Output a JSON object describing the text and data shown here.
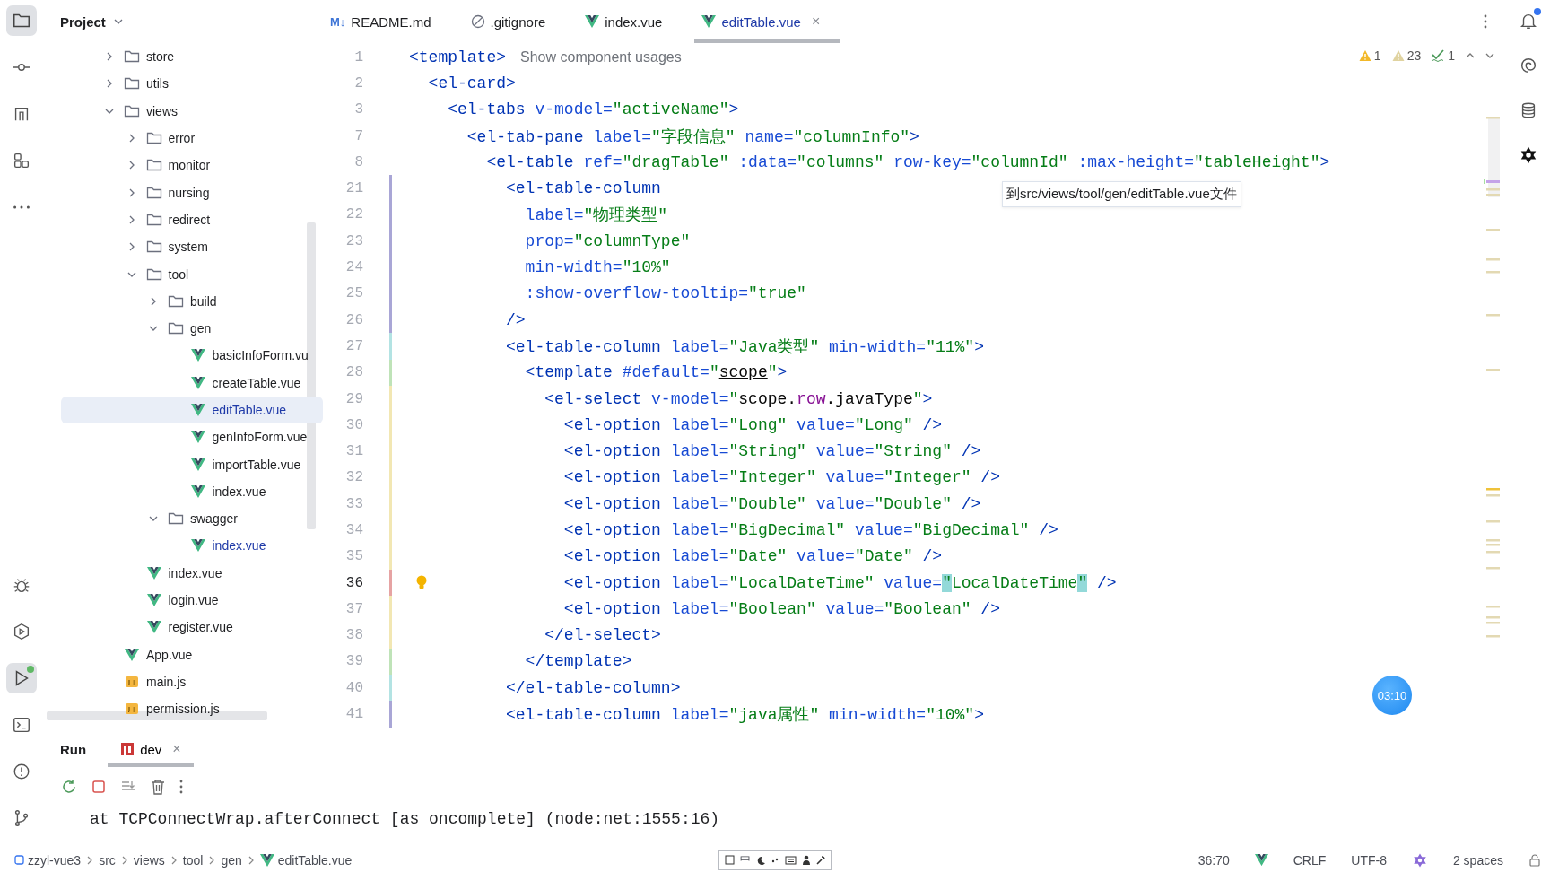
{
  "left_toolbar": {
    "top": [
      {
        "kind": "project",
        "selected": true,
        "badge": false
      },
      {
        "kind": "commit",
        "selected": false,
        "badge": false
      },
      {
        "kind": "structure",
        "selected": false,
        "badge": false
      },
      {
        "kind": "plugins",
        "selected": false,
        "badge": false
      },
      {
        "kind": "more",
        "selected": false,
        "badge": false
      }
    ],
    "bottom": [
      {
        "kind": "debug",
        "selected": false,
        "badge": false
      },
      {
        "kind": "services",
        "selected": false,
        "badge": false
      },
      {
        "kind": "run",
        "selected": true,
        "badge": true
      },
      {
        "kind": "terminal",
        "selected": false,
        "badge": false
      },
      {
        "kind": "problems",
        "selected": false,
        "badge": false
      },
      {
        "kind": "git",
        "selected": false,
        "badge": false
      }
    ]
  },
  "project": {
    "title": "Project",
    "tree": [
      {
        "kind": "folder",
        "label": "store",
        "expanded": false,
        "selected": false
      },
      {
        "kind": "folder",
        "label": "utils",
        "expanded": false,
        "selected": false
      },
      {
        "kind": "folder",
        "label": "views",
        "expanded": true,
        "selected": false,
        "children": [
          {
            "kind": "folder",
            "label": "error",
            "expanded": false,
            "selected": false
          },
          {
            "kind": "folder",
            "label": "monitor",
            "expanded": false,
            "selected": false
          },
          {
            "kind": "folder",
            "label": "nursing",
            "expanded": false,
            "selected": false
          },
          {
            "kind": "folder",
            "label": "redirect",
            "expanded": false,
            "selected": false
          },
          {
            "kind": "folder",
            "label": "system",
            "expanded": false,
            "selected": false
          },
          {
            "kind": "folder",
            "label": "tool",
            "expanded": true,
            "selected": false,
            "children": [
              {
                "kind": "folder",
                "label": "build",
                "expanded": false,
                "selected": false
              },
              {
                "kind": "folder",
                "label": "gen",
                "expanded": true,
                "selected": false,
                "children": [
                  {
                    "kind": "vue",
                    "label": "basicInfoForm.vu",
                    "modified": false,
                    "selected": false
                  },
                  {
                    "kind": "vue",
                    "label": "createTable.vue",
                    "modified": false,
                    "selected": false
                  },
                  {
                    "kind": "vue",
                    "label": "editTable.vue",
                    "modified": true,
                    "selected": true
                  },
                  {
                    "kind": "vue",
                    "label": "genInfoForm.vue",
                    "modified": false,
                    "selected": false
                  },
                  {
                    "kind": "vue",
                    "label": "importTable.vue",
                    "modified": false,
                    "selected": false
                  },
                  {
                    "kind": "vue",
                    "label": "index.vue",
                    "modified": false,
                    "selected": false
                  }
                ]
              },
              {
                "kind": "folder",
                "label": "swagger",
                "expanded": true,
                "selected": false,
                "children": [
                  {
                    "kind": "vue",
                    "label": "index.vue",
                    "modified": true,
                    "selected": false
                  }
                ]
              }
            ]
          },
          {
            "kind": "vue",
            "label": "index.vue",
            "modified": false,
            "selected": false
          },
          {
            "kind": "vue",
            "label": "login.vue",
            "modified": false,
            "selected": false
          },
          {
            "kind": "vue",
            "label": "register.vue",
            "modified": false,
            "selected": false
          }
        ]
      },
      {
        "kind": "vue",
        "label": "App.vue",
        "modified": false,
        "selected": false
      },
      {
        "kind": "js",
        "label": "main.js",
        "modified": false,
        "selected": false
      },
      {
        "kind": "js",
        "label": "permission.js",
        "modified": false,
        "selected": false
      }
    ]
  },
  "tabs": [
    {
      "kind": "markdown",
      "icon_text": "M↓",
      "label": "README.md",
      "selected": false
    },
    {
      "kind": "ignore",
      "label": ".gitignore",
      "selected": false
    },
    {
      "kind": "vue",
      "label": "index.vue",
      "selected": false
    },
    {
      "kind": "vue",
      "label": "editTable.vue",
      "selected": true,
      "close": "×"
    }
  ],
  "inspections": [
    {
      "kind": "warning",
      "count": "1"
    },
    {
      "kind": "weak-warning",
      "count": "23"
    },
    {
      "kind": "typo",
      "count": "1"
    }
  ],
  "code_lines": [
    {
      "number": "1",
      "current": false,
      "tokens": [
        {
          "kind": "tag",
          "text": "<template>"
        },
        {
          "kind": "hint",
          "text": "Show component usages"
        }
      ]
    },
    {
      "number": "2",
      "current": false,
      "tokens": [
        {
          "kind": "tag",
          "text": "  <el-card>"
        }
      ]
    },
    {
      "number": "3",
      "current": false,
      "tokens": [
        {
          "kind": "tag",
          "text": "    <el-tabs"
        },
        {
          "kind": "attr",
          "text": " v-model="
        },
        {
          "kind": "str",
          "text": "\"activeName\""
        },
        {
          "kind": "tag",
          "text": ">"
        }
      ]
    },
    {
      "number": "7",
      "current": false,
      "tokens": [
        {
          "kind": "tag",
          "text": "      <el-tab-pane"
        },
        {
          "kind": "attr",
          "text": " label="
        },
        {
          "kind": "str",
          "text": "\"字段信息\""
        },
        {
          "kind": "attr",
          "text": " name="
        },
        {
          "kind": "str",
          "text": "\"columnInfo\""
        },
        {
          "kind": "tag",
          "text": ">"
        }
      ]
    },
    {
      "number": "8",
      "current": false,
      "tokens": [
        {
          "kind": "tag",
          "text": "        <el-table"
        },
        {
          "kind": "attr",
          "text": " ref="
        },
        {
          "kind": "str",
          "text": "\"dragTable\""
        },
        {
          "kind": "attr",
          "text": " :data="
        },
        {
          "kind": "str",
          "text": "\"columns\""
        },
        {
          "kind": "attr",
          "text": " row-key="
        },
        {
          "kind": "str",
          "text": "\"columnId\""
        },
        {
          "kind": "attr",
          "text": " :max-height="
        },
        {
          "kind": "str",
          "text": "\"tableHeight\""
        },
        {
          "kind": "tag",
          "text": ">"
        }
      ]
    },
    {
      "number": "21",
      "current": false,
      "color": "#a9a6d6",
      "tokens": [
        {
          "kind": "tag",
          "text": "          <el-table-column"
        }
      ]
    },
    {
      "number": "22",
      "current": false,
      "color": "#a9a6d6",
      "tokens": [
        {
          "kind": "attr",
          "text": "            label="
        },
        {
          "kind": "str",
          "text": "\"物理类型\""
        }
      ]
    },
    {
      "number": "23",
      "current": false,
      "color": "#a9a6d6",
      "tokens": [
        {
          "kind": "attr",
          "text": "            prop="
        },
        {
          "kind": "str",
          "text": "\"columnType\""
        }
      ]
    },
    {
      "number": "24",
      "current": false,
      "color": "#a9a6d6",
      "tokens": [
        {
          "kind": "attr",
          "text": "            min-width="
        },
        {
          "kind": "str",
          "text": "\"10%\""
        }
      ]
    },
    {
      "number": "25",
      "current": false,
      "color": "#a9a6d6",
      "tokens": [
        {
          "kind": "attr",
          "text": "            :show-overflow-tooltip="
        },
        {
          "kind": "str",
          "text": "\"true\""
        }
      ]
    },
    {
      "number": "26",
      "current": false,
      "color": "#a9a6d6",
      "tokens": [
        {
          "kind": "tag",
          "text": "          />"
        }
      ]
    },
    {
      "number": "27",
      "current": false,
      "color": "#b3e3e3",
      "tokens": [
        {
          "kind": "tag",
          "text": "          <el-table-column"
        },
        {
          "kind": "attr",
          "text": " label="
        },
        {
          "kind": "str",
          "text": "\"Java类型\""
        },
        {
          "kind": "attr",
          "text": " min-width="
        },
        {
          "kind": "str",
          "text": "\"11%\""
        },
        {
          "kind": "tag",
          "text": ">"
        }
      ]
    },
    {
      "number": "28",
      "current": false,
      "color": "#bfe3b8",
      "tokens": [
        {
          "kind": "tag",
          "text": "            <template"
        },
        {
          "kind": "attr",
          "text": " #default="
        },
        {
          "kind": "str",
          "text": "\""
        },
        {
          "kind": "ref",
          "text": "scope"
        },
        {
          "kind": "str",
          "text": "\""
        },
        {
          "kind": "tag",
          "text": ">"
        }
      ]
    },
    {
      "number": "29",
      "current": false,
      "color": "#f2e7b3",
      "tokens": [
        {
          "kind": "tag",
          "text": "              <el-select"
        },
        {
          "kind": "attr",
          "text": " v-model="
        },
        {
          "kind": "str",
          "text": "\""
        },
        {
          "kind": "ref",
          "text": "scope"
        },
        {
          "kind": "plain",
          "text": "."
        },
        {
          "kind": "prop",
          "text": "row"
        },
        {
          "kind": "plain",
          "text": ".javaType"
        },
        {
          "kind": "str",
          "text": "\""
        },
        {
          "kind": "tag",
          "text": ">"
        }
      ]
    },
    {
      "number": "30",
      "current": false,
      "color": "#f2e7b3",
      "tokens": [
        {
          "kind": "tag",
          "text": "                <el-option"
        },
        {
          "kind": "attr",
          "text": " label="
        },
        {
          "kind": "str",
          "text": "\"Long\""
        },
        {
          "kind": "attr",
          "text": " value="
        },
        {
          "kind": "str",
          "text": "\"Long\""
        },
        {
          "kind": "tag",
          "text": " />"
        }
      ]
    },
    {
      "number": "31",
      "current": false,
      "color": "#f2e7b3",
      "tokens": [
        {
          "kind": "tag",
          "text": "                <el-option"
        },
        {
          "kind": "attr",
          "text": " label="
        },
        {
          "kind": "str",
          "text": "\"String\""
        },
        {
          "kind": "attr",
          "text": " value="
        },
        {
          "kind": "str",
          "text": "\"String\""
        },
        {
          "kind": "tag",
          "text": " />"
        }
      ]
    },
    {
      "number": "32",
      "current": false,
      "color": "#f2e7b3",
      "tokens": [
        {
          "kind": "tag",
          "text": "                <el-option"
        },
        {
          "kind": "attr",
          "text": " label="
        },
        {
          "kind": "str",
          "text": "\"Integer\""
        },
        {
          "kind": "attr",
          "text": " value="
        },
        {
          "kind": "str",
          "text": "\"Integer\""
        },
        {
          "kind": "tag",
          "text": " />"
        }
      ]
    },
    {
      "number": "33",
      "current": false,
      "color": "#f2e7b3",
      "tokens": [
        {
          "kind": "tag",
          "text": "                <el-option"
        },
        {
          "kind": "attr",
          "text": " label="
        },
        {
          "kind": "str",
          "text": "\"Double\""
        },
        {
          "kind": "attr",
          "text": " value="
        },
        {
          "kind": "str",
          "text": "\"Double\""
        },
        {
          "kind": "tag",
          "text": " />"
        }
      ]
    },
    {
      "number": "34",
      "current": false,
      "color": "#f2e7b3",
      "tokens": [
        {
          "kind": "tag",
          "text": "                <el-option"
        },
        {
          "kind": "attr",
          "text": " label="
        },
        {
          "kind": "str",
          "text": "\"BigDecimal\""
        },
        {
          "kind": "attr",
          "text": " value="
        },
        {
          "kind": "str",
          "text": "\"BigDecimal\""
        },
        {
          "kind": "tag",
          "text": " />"
        }
      ]
    },
    {
      "number": "35",
      "current": false,
      "color": "#f2e7b3",
      "tokens": [
        {
          "kind": "tag",
          "text": "                <el-option"
        },
        {
          "kind": "attr",
          "text": " label="
        },
        {
          "kind": "str",
          "text": "\"Date\""
        },
        {
          "kind": "attr",
          "text": " value="
        },
        {
          "kind": "str",
          "text": "\"Date\""
        },
        {
          "kind": "tag",
          "text": " />"
        }
      ]
    },
    {
      "number": "36",
      "current": true,
      "color": "#e6a3a3",
      "tokens": [
        {
          "kind": "tag",
          "text": "                <el-option"
        },
        {
          "kind": "attr",
          "text": " label="
        },
        {
          "kind": "str",
          "text": "\"LocalDateTime\""
        },
        {
          "kind": "attr",
          "text": " value="
        },
        {
          "kind": "match",
          "text": "\""
        },
        {
          "kind": "str",
          "text": "LocalDateTime"
        },
        {
          "kind": "match",
          "text": "\""
        },
        {
          "kind": "tag",
          "text": " />"
        }
      ]
    },
    {
      "number": "37",
      "current": false,
      "color": "#f2e7b3",
      "tokens": [
        {
          "kind": "tag",
          "text": "                <el-option"
        },
        {
          "kind": "attr",
          "text": " label="
        },
        {
          "kind": "str",
          "text": "\"Boolean\""
        },
        {
          "kind": "attr",
          "text": " value="
        },
        {
          "kind": "str",
          "text": "\"Boolean\""
        },
        {
          "kind": "tag",
          "text": " />"
        }
      ]
    },
    {
      "number": "38",
      "current": false,
      "color": "#f2e7b3",
      "tokens": [
        {
          "kind": "tag",
          "text": "              </el-select>"
        }
      ]
    },
    {
      "number": "39",
      "current": false,
      "color": "#bfe3b8",
      "tokens": [
        {
          "kind": "tag",
          "text": "            </template>"
        }
      ]
    },
    {
      "number": "40",
      "current": false,
      "color": "#b3e3e3",
      "tokens": [
        {
          "kind": "tag",
          "text": "          </el-table-column>"
        }
      ]
    },
    {
      "number": "41",
      "current": false,
      "color": "#a9a6d6",
      "tokens": [
        {
          "kind": "tag",
          "text": "          <el-table-column"
        },
        {
          "kind": "attr",
          "text": " label="
        },
        {
          "kind": "str",
          "text": "\"java属性\""
        },
        {
          "kind": "attr",
          "text": " min-width="
        },
        {
          "kind": "str",
          "text": "\"10%\""
        },
        {
          "kind": "tag",
          "text": ">"
        }
      ]
    }
  ],
  "tooltip": "到src/views/tool/gen/editTable.vue文件",
  "timer": "03:10",
  "run_panel": {
    "title": "Run",
    "tabs": [
      {
        "label": "dev",
        "selected": true,
        "close": "×"
      }
    ],
    "console": "at TCPConnectWrap.afterConnect [as oncomplete] (node:net:1555:16)"
  },
  "right_toolbar": [
    {
      "kind": "notifications",
      "badge": true
    },
    {
      "kind": "assistant",
      "badge": false
    },
    {
      "kind": "database",
      "badge": false
    },
    {
      "kind": "plugin",
      "badge": false
    }
  ],
  "status_bar": {
    "breadcrumbs": [
      {
        "kind": "module",
        "label": "zzyl-vue3"
      },
      {
        "kind": "folder",
        "label": "src"
      },
      {
        "kind": "folder",
        "label": "views"
      },
      {
        "kind": "folder",
        "label": "tool"
      },
      {
        "kind": "folder",
        "label": "gen"
      },
      {
        "kind": "vue",
        "label": "editTable.vue"
      }
    ],
    "ime_label": "中",
    "position": "36:70",
    "line_separator": "CRLF",
    "encoding": "UTF-8",
    "indent": "2 spaces"
  }
}
